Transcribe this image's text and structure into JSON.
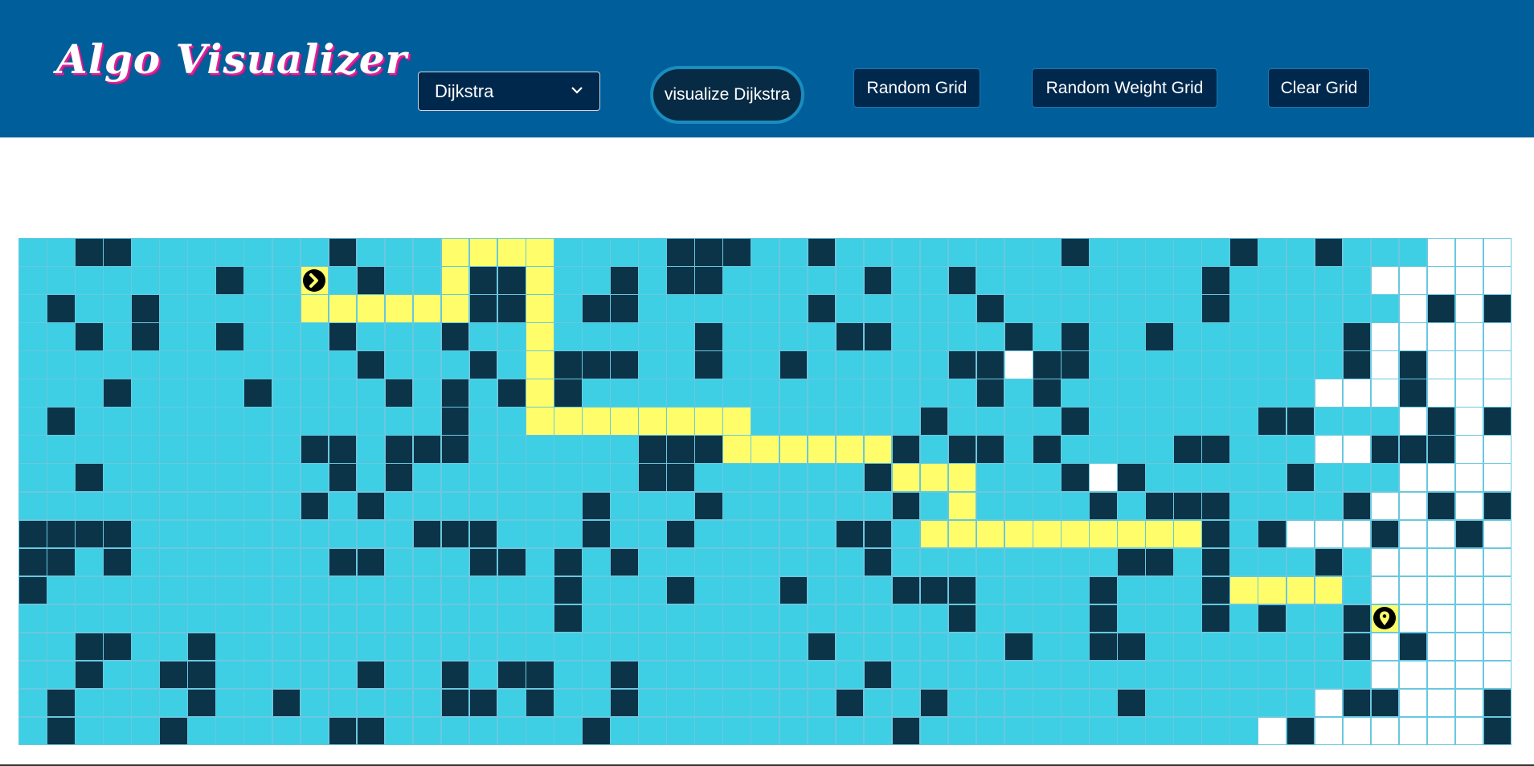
{
  "app": {
    "brand": "Algo Visualizer"
  },
  "toolbar": {
    "algorithm_select": {
      "value": "Dijkstra",
      "options": [
        "Dijkstra"
      ]
    },
    "visualize_label": "visualize Dijkstra",
    "random_grid_label": "Random Grid",
    "random_weight_grid_label": "Random Weight Grid",
    "clear_grid_label": "Clear Grid"
  },
  "colors": {
    "navbar": "#005f9a",
    "unvisited": "#ffffff",
    "visited": "#3ecfe4",
    "wall": "#0c3449",
    "path": "#fffe6a",
    "cell_border": "#69c8e0"
  },
  "grid": {
    "rows": 18,
    "cols": 53,
    "legend": {
      "U": "unvisited",
      "V": "visited",
      "W": "wall",
      "P": "path",
      "S": "start",
      "E": "end"
    },
    "cells": [
      "VVWWVVVVVVVWVVVPPPPVVVVWWWVVWVVVVVVVVWVVVVVWVVWVVVUUUUUW",
      "VVVVVVVWVVSVWVVPWWPVVWVWWVVVVVWVVWVVVVVVVVWVVVVVUUUUUU",
      "VWVVWVVVVVPPPPPPWWPVWWVVVVVVWVVVVVWVVVVVVVWVVVVVVUWUW",
      "VVWVWVVWVVVWVVVWVVPVVVVVWVVVVWWVVVVWVWVVWVVVVVVWUUU",
      "VVVVVVVVVVVVWVVVWVPWWWVVWVVWVVVVVWWUWWVVVVVVVVVWUWU",
      "VVVWVVVVWVVVVWVWVWPWVVVVVVVVVVVVVVWVWVVVVVVVVVUUUWU",
      "VWVVVVVVVVVVVVVWVVPPPPPPPPVVVVVVWVVVVWVVVVVVWWVVVUWUWUW",
      "VVVVVVVVVVWWVWWWVVVVVVWWWPPPPPPWVWWVWVVVVWWVVVUUWWWUU",
      "VVWVVVVVVVVWVWVVVVVVVVWWVVVVVVWPPPVVVWUWVVVVVWVVVUUUUU",
      "VVVVVVVVVVWVWVVVVVVVWVVVWVVVVVVWVPVVVVWVWWWVVVVWUUWUWU",
      "WWWWVVVVVVVVVVWWWVVVWVVWVVVVVWWVPPPPPPPPPPWVWUUUWUUWU",
      "WWVWVVVVVVVWWVVVWWVWVWVVVVVVVVWVVVVVVVVWWVWVVVWVUUUUUU",
      "WVVVVVVVVVVVVVVVVVVWVVVWVVVWVVVWWWVVVVWVVVWPPPPVUUUUUU",
      "VVVVVVVVVVVVVVVVVVVWVVVVVVVVVVVVVWVVVVWVVVWVWVVWEUUUUWUW",
      "VVWWVVWVVVVVVVVVVVVVVVVVVVVVWVVVVVVWVVWWVVVVVVVWUWUUUUUU",
      "VVWVVWWVVVVVWVVWVWWVVWVVVVVVVVWVVVVVVVVVVVVVVVVVUUUUUUU",
      "VWVVVVWVVWVVVVVWWVWVVWVVVVVVVWVVWVVVVVVWVVVVVVUWWUUUWWU",
      "VWVVVWVVVVVWWVVVVVVVWVVVVVVVVVVWVVVVVVVVVVVVUWUUUUUUWU"
    ]
  }
}
